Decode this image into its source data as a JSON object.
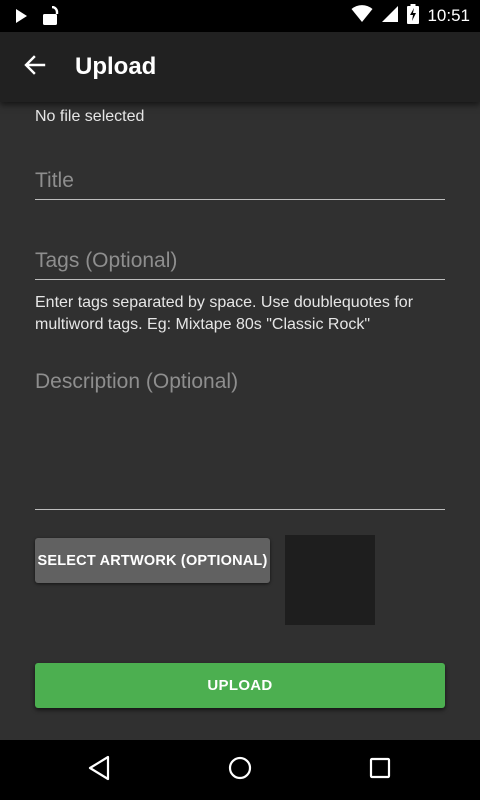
{
  "status_bar": {
    "time": "10:51",
    "icons": [
      "play-icon",
      "unlock-icon",
      "wifi-icon",
      "signal-icon",
      "battery-charging-icon"
    ]
  },
  "app_bar": {
    "back_icon": "arrow-back-icon",
    "title": "Upload"
  },
  "form": {
    "file_status": "No file selected",
    "title_placeholder": "Title",
    "tags_placeholder": "Tags (Optional)",
    "tags_hint": "Enter tags separated by space. Use doublequotes for multiword tags. Eg: Mixtape 80s \"Classic Rock\"",
    "description_placeholder": "Description (Optional)",
    "select_artwork_label": "SELECT ARTWORK (OPTIONAL)",
    "upload_label": "UPLOAD"
  },
  "nav_bar": {
    "icons": [
      "nav-back-icon",
      "nav-home-icon",
      "nav-recents-icon"
    ]
  },
  "colors": {
    "accent": "#4caf50",
    "app_bar": "#212121",
    "background": "#303030",
    "secondary_button": "#616161"
  }
}
